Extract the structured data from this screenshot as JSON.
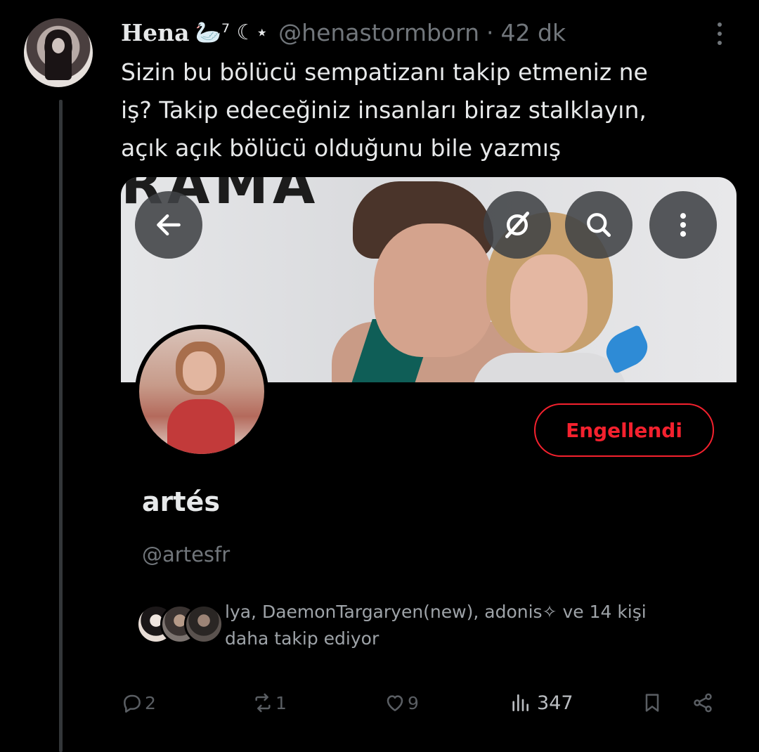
{
  "tweet": {
    "author_name": "Hena",
    "author_name_deco": "🦢⁷ ☾⋆",
    "author_handle": "@henastormborn",
    "separator": "·",
    "time": "42 dk",
    "text_lines": [
      "Sizin bu bölücü sempatizanı takip etmeniz ne",
      "iş? Takip edeceğiniz insanları biraz stalklayın,",
      "açık açık bölücü olduğunu bile yazmış"
    ]
  },
  "embedded_profile": {
    "banner_text": "RAMA",
    "display_name": "artés",
    "handle": "@artesfr",
    "blocked_button_label": "Engellendi",
    "followers_line_1": "lya, DaemonTargaryen(new), adonis✧ ve 14 kişi",
    "followers_line_2": "daha takip ediyor",
    "top_buttons": [
      "back-arrow-icon",
      "grok-icon",
      "search-icon",
      "more-vertical-icon"
    ]
  },
  "actions": {
    "replies": "2",
    "reposts": "1",
    "likes": "9",
    "views": "347"
  },
  "colors": {
    "background": "#000000",
    "text_primary": "#e7e9ea",
    "text_secondary": "#71767b",
    "blocked_red": "#f4212e",
    "thread_line": "#333639"
  }
}
